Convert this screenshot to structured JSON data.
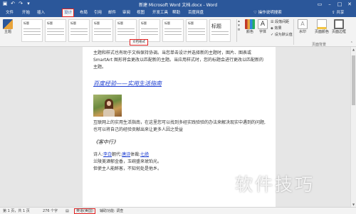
{
  "window": {
    "title": "新建 Microsoft Word 文档.docx - Word"
  },
  "tabs": [
    "文件",
    "开始",
    "插入",
    "设计",
    "布局",
    "引用",
    "邮件",
    "审阅",
    "视图",
    "开发工具",
    "帮助",
    "百度网盘"
  ],
  "active_tab": "设计",
  "tell_me": "操作说明搜索",
  "share": "共享",
  "ribbon": {
    "theme_label": "主题",
    "gallery_titles": [
      "标题",
      "标题",
      "标题",
      "标题",
      "标题",
      "标题",
      "标题",
      "标题",
      "标题"
    ],
    "colors_label": "颜色",
    "fonts_label": "字体",
    "paragraph_spacing": "段落间距",
    "effects": "效果",
    "set_default": "设为默认值",
    "watermark": "水印",
    "page_color": "页面颜色",
    "page_borders": "页面边框",
    "page_background": "页面背景",
    "doc_format_group": "文档格式"
  },
  "tooltip": "文档格式",
  "document": {
    "para1": "主题和样式也有助于文档保持协调。当您单击设计并选择新的主题时，图片、图表或 SmartArt 图形将会更改以匹配新的主题。当应用样式时，您的标题会进行更改以匹配新的主题。",
    "para1_link": "当应用",
    "heading": "百度经验——实用生活指南",
    "para2": "互联网上的实用生活指南，在这里您可以找到多经实践验验的办法来解决现实中遇到的问题,也可以将自己的经验贡献出来让更多人因之受益",
    "poem_title": "《客中行》",
    "poem_line1_prefix": "诗人:",
    "poem_author": "李白",
    "poem_line1_mid": "朝代:",
    "poem_dynasty": "唐诗",
    "poem_line1_style": "体裁:",
    "poem_genre": "七绝",
    "poem_line2": "兰陵美酒郁金香，玉碗盛来琥珀光。",
    "poem_line3": "但使主人能醉客，不知何处是他乡。"
  },
  "statusbar": {
    "page": "第 1 页，共 1 页",
    "words": "276 个字",
    "icon_check": "校对",
    "language": "英语(美国)",
    "accessibility": "辅助功能: 调查"
  },
  "watermark_text": "软件技巧",
  "colors": {
    "word_blue": "#2b579a",
    "highlight_red": "#e02020",
    "link_blue": "#1a3bd0"
  }
}
